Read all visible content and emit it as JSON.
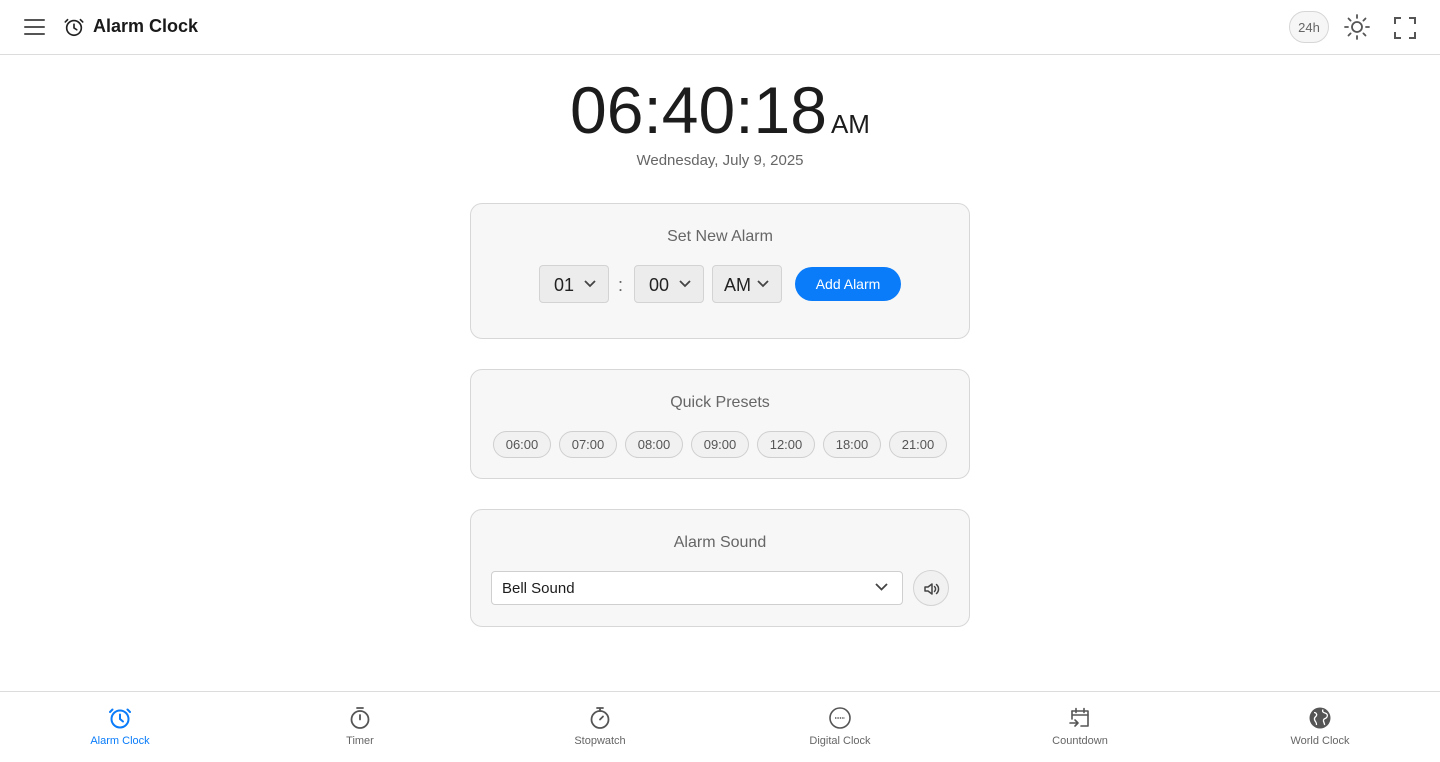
{
  "header": {
    "title": "Alarm Clock",
    "format_toggle": "24h"
  },
  "clock": {
    "time": "06:40:18",
    "ampm": "AM",
    "date": "Wednesday, July 9, 2025"
  },
  "new_alarm": {
    "title": "Set New Alarm",
    "hour": "01",
    "separator": ":",
    "minute": "00",
    "period": "AM",
    "add_label": "Add Alarm"
  },
  "presets": {
    "title": "Quick Presets",
    "items": [
      "06:00",
      "07:00",
      "08:00",
      "09:00",
      "12:00",
      "18:00",
      "21:00"
    ]
  },
  "sound": {
    "title": "Alarm Sound",
    "selected": "Bell Sound"
  },
  "nav": {
    "items": [
      {
        "label": "Alarm Clock",
        "icon": "alarm-clock-icon",
        "active": true
      },
      {
        "label": "Timer",
        "icon": "timer-icon",
        "active": false
      },
      {
        "label": "Stopwatch",
        "icon": "stopwatch-icon",
        "active": false
      },
      {
        "label": "Digital Clock",
        "icon": "digital-clock-icon",
        "active": false
      },
      {
        "label": "Countdown",
        "icon": "countdown-icon",
        "active": false
      },
      {
        "label": "World Clock",
        "icon": "globe-icon",
        "active": false
      }
    ]
  },
  "colors": {
    "accent": "#0a7cf9",
    "muted_text": "#666666",
    "card_bg": "#f7f7f7"
  }
}
